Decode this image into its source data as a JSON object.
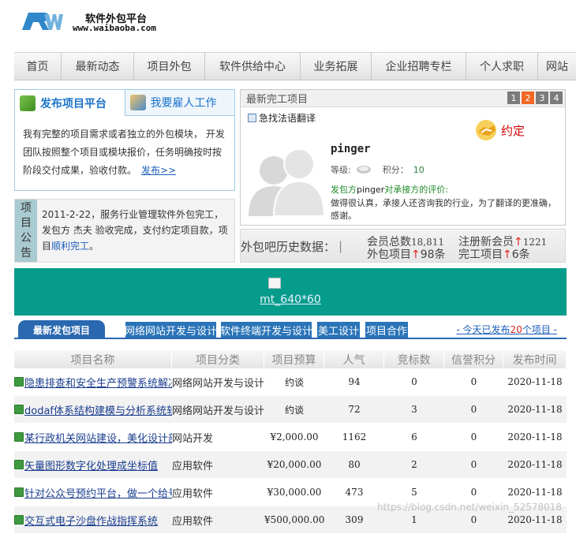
{
  "header": {
    "logo_text": "RW",
    "title": "软件外包平台",
    "url": "www.waibaoba.com"
  },
  "nav": {
    "items": [
      "首页",
      "最新动态",
      "项目外包",
      "软件供给中心",
      "业务拓展",
      "企业招聘专栏",
      "个人求职",
      "网站"
    ]
  },
  "publish_box": {
    "tab_publish": "发布项目平台",
    "tab_hire": "我要雇人工作",
    "text": "我有完整的项目需求或者独立的外包模块， 开发团队按照整个项目或模块报价，任务明确按时按阶段交付成果，验收付款。",
    "link": "发布>>"
  },
  "notice": {
    "label": [
      "项",
      "目",
      "公",
      "告"
    ],
    "text_before": "2011-2-22，服务行业管理软件外包完工，发包方 杰夫 验收完成，支付约定项目款，项目",
    "text_highlight": "顺利完工",
    "text_after": "。"
  },
  "completed": {
    "header": "最新完工项目",
    "pages": [
      "1",
      "2",
      "3",
      "4"
    ],
    "active_page": "2",
    "project_title": "急找法语翻译",
    "badge": "约定",
    "user": "pinger",
    "level_label": "等级:",
    "score_label": "积分：",
    "score": "10",
    "eval_prefix": "发包方",
    "eval_name": "pinger",
    "eval_suffix": "对承接方的评价:",
    "eval_text": "做得很认真，承接人还咨询我的行业，为了翻译的更准确，感谢。"
  },
  "stats": {
    "title": "外包吧历史数据：",
    "sep": "|",
    "members_label": "会员总数",
    "members": "18,811",
    "new_members_label": "注册新会员",
    "new_members": "1221",
    "projects_label": "外包项目",
    "projects": "98条",
    "done_label": "完工项目",
    "done": "6条",
    "up": "↑"
  },
  "banner": {
    "alt": "mt_640*60",
    "color": "#069c8c"
  },
  "latest": {
    "tab": "最新发包项目",
    "categories": [
      "网络网站开发与设计",
      "软件终端开发与设计",
      "美工设计",
      "项目合作"
    ],
    "today_before": "- 今天已发布",
    "today_count": "20",
    "today_after": "个项目 -"
  },
  "table": {
    "headers": [
      "项目名称",
      "项目分类",
      "项目预算",
      "人气",
      "竞标数",
      "信誉积分",
      "发布时间"
    ],
    "rows": [
      {
        "name": "隐患排查和安全生产预警系统解决",
        "category": "网络网站开发与设计",
        "budget": "约谈",
        "views": "94",
        "bids": "0",
        "credit": "0",
        "date": "2020-11-18"
      },
      {
        "name": "dodaf体系结构建模与分析系统软",
        "category": "网络网站开发与设计",
        "budget": "约谈",
        "views": "72",
        "bids": "3",
        "credit": "0",
        "date": "2020-11-18"
      },
      {
        "name": "某行政机关网站建设，美化设计部",
        "category": "网站开发",
        "budget": "¥2,000.00",
        "views": "1162",
        "bids": "6",
        "credit": "0",
        "date": "2020-11-18"
      },
      {
        "name": "矢量图形数字化处理成坐标值",
        "category": "应用软件",
        "budget": "¥20,000.00",
        "views": "80",
        "bids": "2",
        "credit": "0",
        "date": "2020-11-18"
      },
      {
        "name": "针对公众号预约平台，做一个给号",
        "category": "应用软件",
        "budget": "¥30,000.00",
        "views": "473",
        "bids": "5",
        "credit": "0",
        "date": "2020-11-18"
      },
      {
        "name": "交互式电子沙盘作战指挥系统",
        "category": "应用软件",
        "budget": "¥500,000.00",
        "views": "309",
        "bids": "1",
        "credit": "0",
        "date": "2020-11-18"
      }
    ]
  },
  "watermark": "https://blog.csdn.net/weixin_52578018"
}
